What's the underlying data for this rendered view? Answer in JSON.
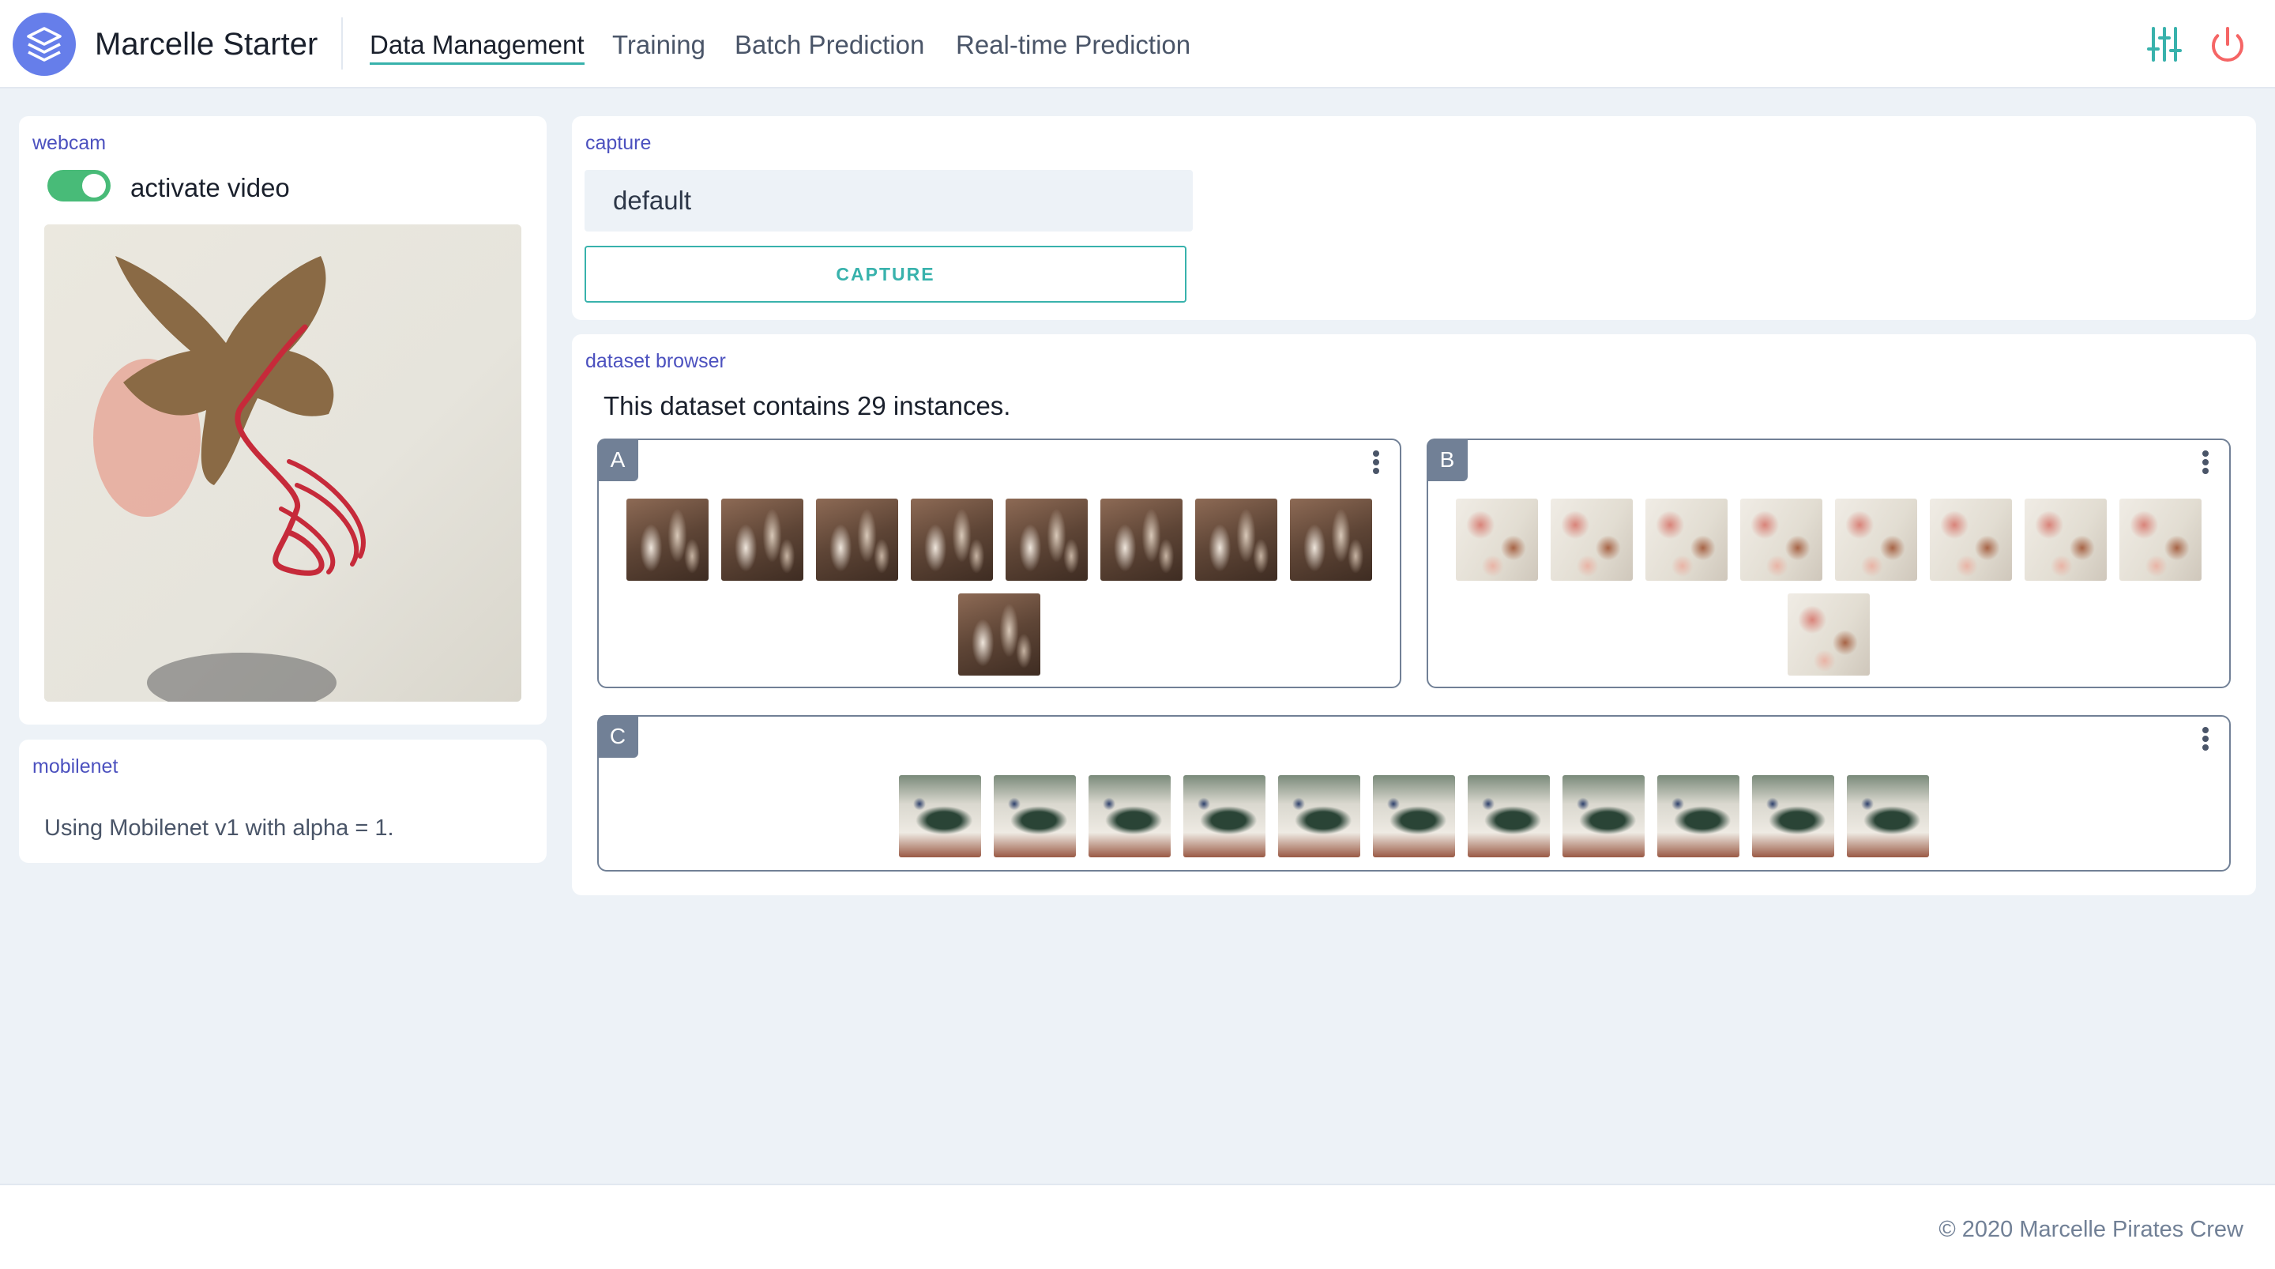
{
  "app": {
    "title": "Marcelle Starter",
    "logo_icon": "layers-icon",
    "accent": "#667eea"
  },
  "nav": {
    "tabs": [
      {
        "label": "Data Management",
        "active": true
      },
      {
        "label": "Training",
        "active": false
      },
      {
        "label": "Batch Prediction",
        "active": false
      },
      {
        "label": "Real-time Prediction",
        "active": false
      }
    ]
  },
  "header_actions": {
    "settings_icon": "sliders-icon",
    "power_icon": "power-icon"
  },
  "webcam": {
    "label": "webcam",
    "toggle_label": "activate video",
    "toggle_on": true
  },
  "mobilenet": {
    "label": "mobilenet",
    "text": "Using Mobilenet v1 with alpha = 1."
  },
  "capture": {
    "label": "capture",
    "input_value": "default",
    "button_label": "CAPTURE"
  },
  "dataset_browser": {
    "label": "dataset browser",
    "summary": "This dataset contains 29 instances.",
    "classes": [
      {
        "name": "A",
        "instance_count": 9
      },
      {
        "name": "B",
        "instance_count": 9
      },
      {
        "name": "C",
        "instance_count": 11
      }
    ]
  },
  "footer": {
    "text": "© 2020 Marcelle Pirates Crew"
  },
  "colors": {
    "toggle_on": "#48bb78",
    "primary": "#38b2ac",
    "label": "#4c51bf",
    "danger": "#f56565"
  }
}
